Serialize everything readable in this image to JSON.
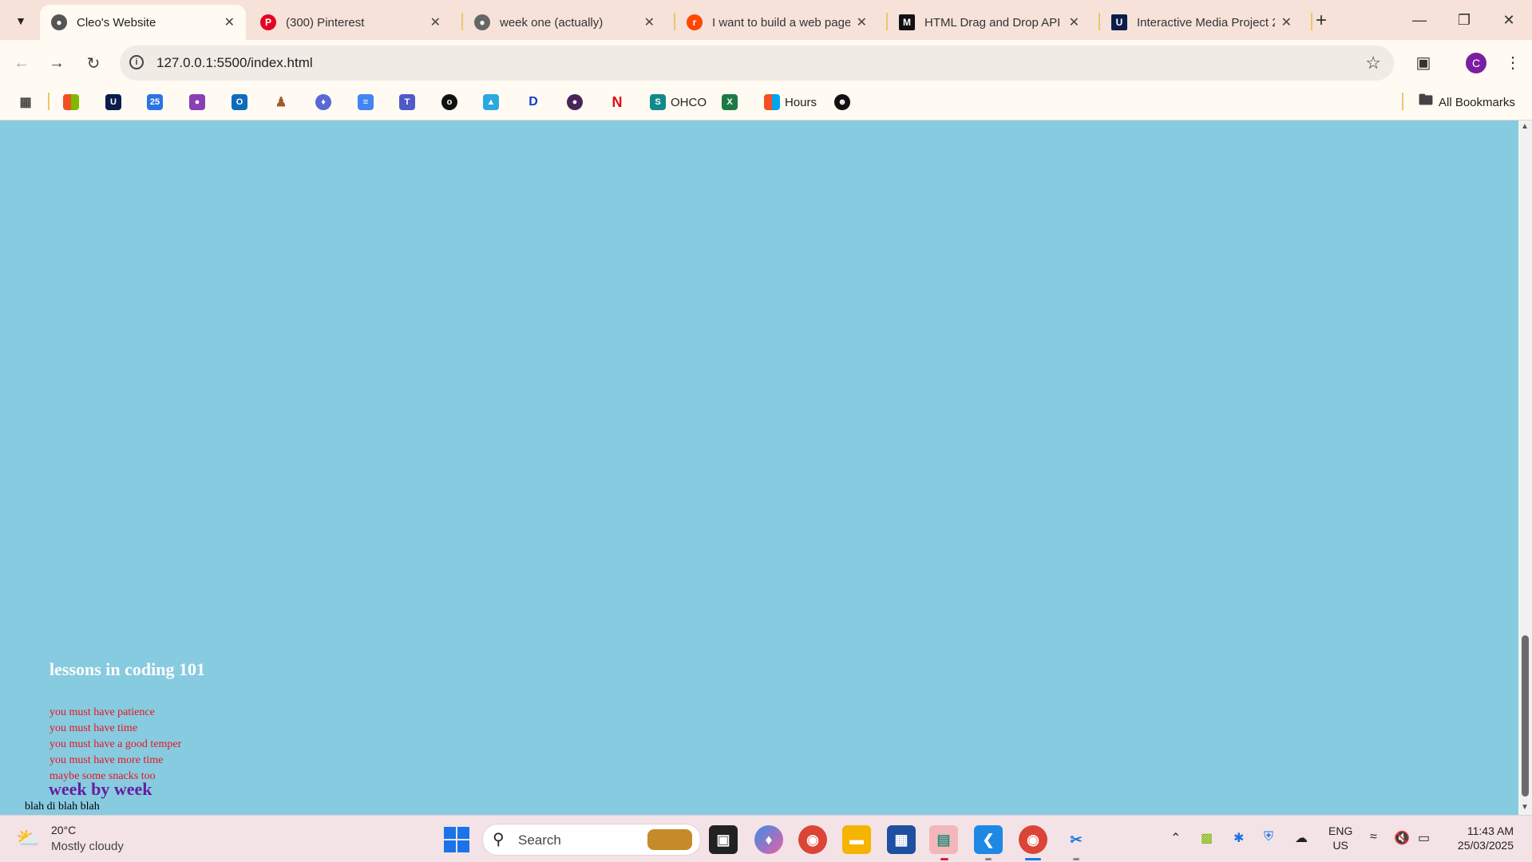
{
  "browser": {
    "tabs": [
      {
        "title": "Cleo's Website",
        "active": true,
        "favicon": "globe-icon"
      },
      {
        "title": "(300) Pinterest",
        "active": false,
        "favicon": "pinterest-icon"
      },
      {
        "title": "week one (actually)",
        "active": false,
        "favicon": "globe-icon"
      },
      {
        "title": "I want to build a web page",
        "active": false,
        "favicon": "reddit-icon"
      },
      {
        "title": "HTML Drag and Drop API",
        "active": false,
        "favicon": "mdn-icon"
      },
      {
        "title": "Interactive Media Project 2",
        "active": false,
        "favicon": "uts-icon"
      }
    ],
    "url": "127.0.0.1:5500/index.html",
    "profile_initial": "C",
    "bookmarks": {
      "ohco_label": "OHCO",
      "hours_label": "Hours",
      "all_label": "All Bookmarks"
    }
  },
  "page": {
    "background": "#87cbe1",
    "heading": "lessons in coding 101",
    "lessons": [
      "you must have patience",
      "you must have time",
      "you must have a good temper",
      "you must have more time",
      "maybe some snacks too"
    ],
    "week_heading": "week by week",
    "body_text": "blah di blah blah"
  },
  "taskbar": {
    "weather_temp": "20°C",
    "weather_desc": "Mostly cloudy",
    "search_label": "Search",
    "lang_line1": "ENG",
    "lang_line2": "US",
    "time": "11:43 AM",
    "date": "25/03/2025"
  }
}
